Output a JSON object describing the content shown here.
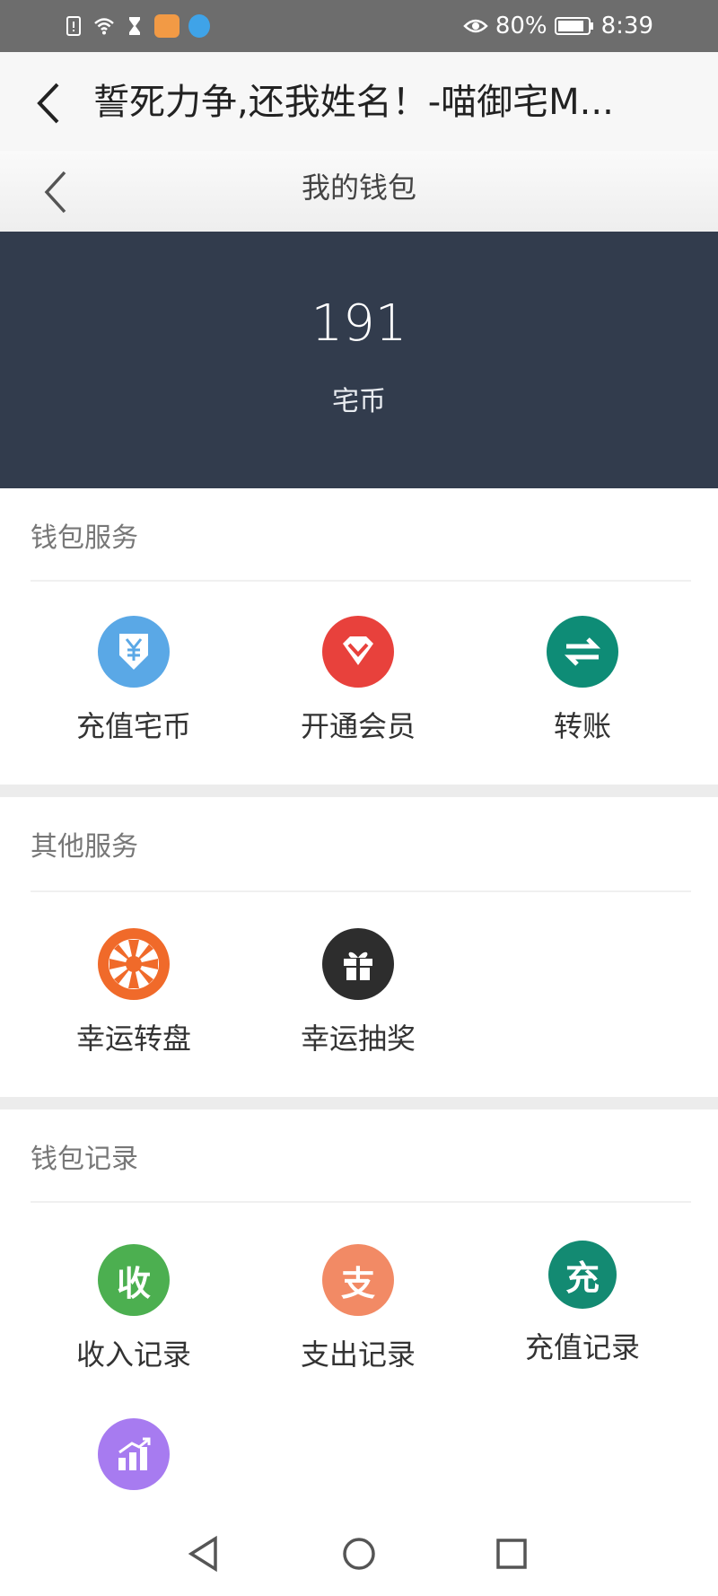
{
  "status_bar": {
    "battery": "80%",
    "time": "8:39",
    "icons": [
      "sim-alert-icon",
      "wifi-icon",
      "hourglass-icon",
      "app-notification-icon",
      "browser-notification-icon"
    ],
    "right_icons": [
      "eye-icon",
      "battery-icon"
    ]
  },
  "app_header": {
    "title": "誓死力争,还我姓名！-喵御宅M..."
  },
  "page_header": {
    "title": "我的钱包"
  },
  "wallet": {
    "balance": "191",
    "unit": "宅币"
  },
  "sections": {
    "wallet_services": {
      "title": "钱包服务",
      "items": [
        {
          "label": "充值宅币",
          "icon": "yen-download-icon",
          "color": "#5aa8e6"
        },
        {
          "label": "开通会员",
          "icon": "diamond-icon",
          "color": "#e8413c"
        },
        {
          "label": "转账",
          "icon": "transfer-arrows-icon",
          "color": "#0e8c76"
        }
      ]
    },
    "other_services": {
      "title": "其他服务",
      "items": [
        {
          "label": "幸运转盘",
          "icon": "wheel-icon",
          "color": "#f06a2a"
        },
        {
          "label": "幸运抽奖",
          "icon": "gift-icon",
          "color": "#2d2d2d"
        }
      ]
    },
    "wallet_records": {
      "title": "钱包记录",
      "items": [
        {
          "label": "收入记录",
          "icon_text": "收",
          "color": "#4caf50"
        },
        {
          "label": "支出记录",
          "icon_text": "支",
          "color": "#f28a65"
        },
        {
          "label": "充值记录",
          "icon_text": "充",
          "color": "#138a72"
        },
        {
          "label": "",
          "icon": "bar-chart-icon",
          "color": "#a77bf0"
        }
      ]
    }
  }
}
